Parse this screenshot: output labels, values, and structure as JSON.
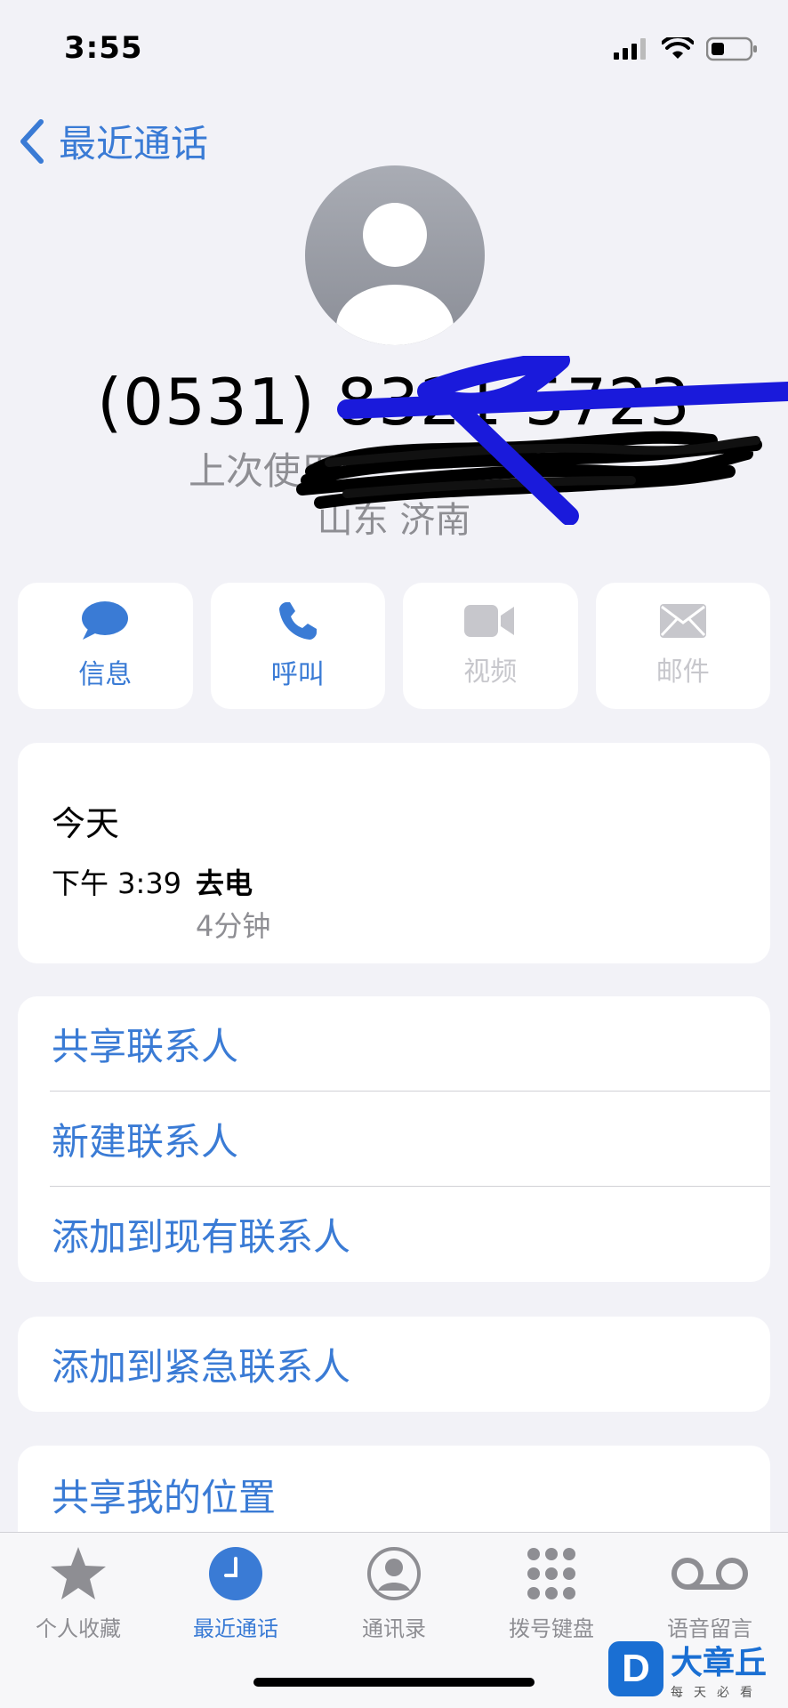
{
  "status": {
    "time": "3:55"
  },
  "nav": {
    "back_label": "最近通话"
  },
  "contact": {
    "number": "(0531) 8321 5723",
    "last_used": "上次使用：",
    "location": "山东 济南"
  },
  "actions": [
    {
      "label": "信息",
      "icon": "message-icon",
      "enabled": true
    },
    {
      "label": "呼叫",
      "icon": "phone-icon",
      "enabled": true
    },
    {
      "label": "视频",
      "icon": "video-icon",
      "enabled": false
    },
    {
      "label": "邮件",
      "icon": "mail-icon",
      "enabled": false
    }
  ],
  "recent": {
    "day": "今天",
    "time": "下午 3:39",
    "type": "去电",
    "duration": "4分钟"
  },
  "options": {
    "group1": [
      "共享联系人",
      "新建联系人",
      "添加到现有联系人"
    ],
    "group2": [
      "添加到紧急联系人"
    ],
    "group3": [
      "共享我的位置"
    ]
  },
  "tabs": [
    {
      "label": "个人收藏",
      "icon": "star-icon"
    },
    {
      "label": "最近通话",
      "icon": "clock-icon",
      "active": true
    },
    {
      "label": "通讯录",
      "icon": "contacts-icon"
    },
    {
      "label": "拨号键盘",
      "icon": "keypad-icon"
    },
    {
      "label": "语音留言",
      "icon": "voicemail-icon"
    }
  ],
  "watermark": {
    "logo": "D",
    "name": "大章丘",
    "slogan": "每天必看"
  },
  "colors": {
    "accent": "#3a7bd5",
    "background": "#f2f2f7",
    "disabled": "#c7c7cc",
    "secondary": "#8e8e93"
  }
}
